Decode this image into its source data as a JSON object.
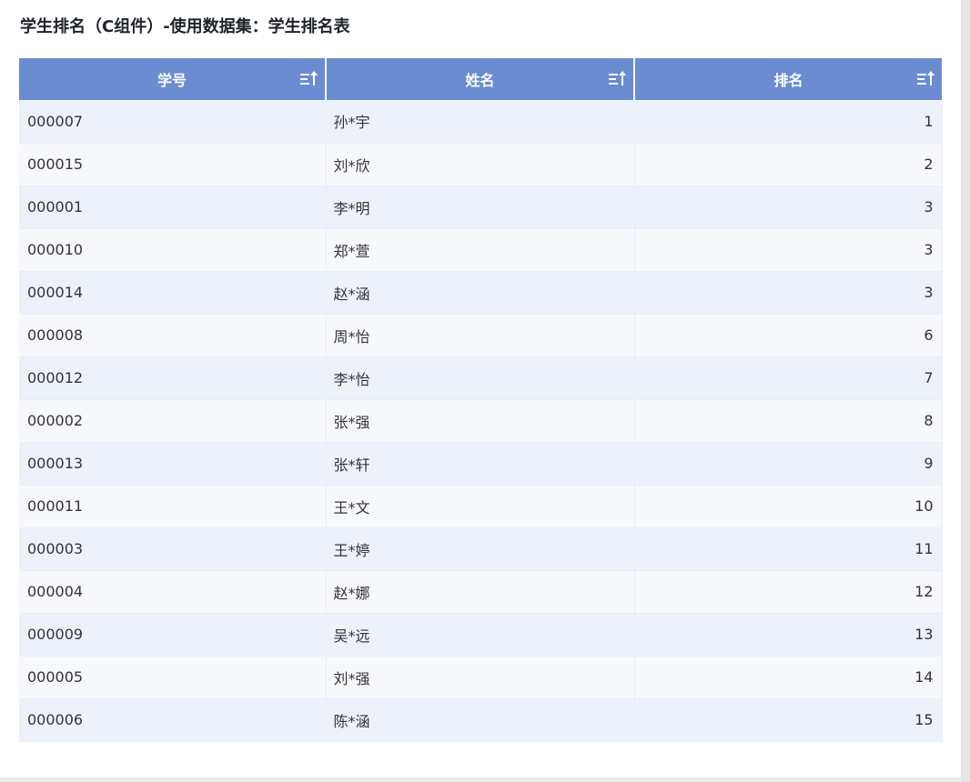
{
  "title": "学生排名（C组件）-使用数据集：学生排名表",
  "columns": [
    {
      "label": "学号",
      "sort_icon": "sort-ascending-icon"
    },
    {
      "label": "姓名",
      "sort_icon": "sort-ascending-icon"
    },
    {
      "label": "排名",
      "sort_icon": "sort-ascending-icon"
    }
  ],
  "rows": [
    {
      "id": "000007",
      "name": "孙*宇",
      "rank": "1"
    },
    {
      "id": "000015",
      "name": "刘*欣",
      "rank": "2"
    },
    {
      "id": "000001",
      "name": "李*明",
      "rank": "3"
    },
    {
      "id": "000010",
      "name": "郑*萱",
      "rank": "3"
    },
    {
      "id": "000014",
      "name": "赵*涵",
      "rank": "3"
    },
    {
      "id": "000008",
      "name": "周*怡",
      "rank": "6"
    },
    {
      "id": "000012",
      "name": "李*怡",
      "rank": "7"
    },
    {
      "id": "000002",
      "name": "张*强",
      "rank": "8"
    },
    {
      "id": "000013",
      "name": "张*轩",
      "rank": "9"
    },
    {
      "id": "000011",
      "name": "王*文",
      "rank": "10"
    },
    {
      "id": "000003",
      "name": "王*婷",
      "rank": "11"
    },
    {
      "id": "000004",
      "name": "赵*娜",
      "rank": "12"
    },
    {
      "id": "000009",
      "name": "吴*远",
      "rank": "13"
    },
    {
      "id": "000005",
      "name": "刘*强",
      "rank": "14"
    },
    {
      "id": "000006",
      "name": "陈*涵",
      "rank": "15"
    }
  ],
  "colors": {
    "header_bg": "#6b8cd1",
    "row_odd": "#edf2fa",
    "row_even": "#f6f8fc"
  }
}
